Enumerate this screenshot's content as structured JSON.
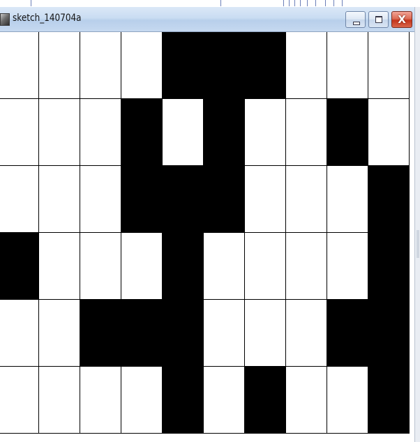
{
  "window": {
    "title": "sketch_140704a",
    "icon": "processing-app-icon",
    "controls": {
      "minimize_icon": "minimize-icon",
      "maximize_icon": "maximize-icon",
      "close_icon": "close-icon",
      "close_glyph": "X"
    }
  },
  "colors": {
    "filled_cell": "#000000",
    "empty_cell": "#ffffff",
    "grid_line": "#000000",
    "close_button": "#c4341b",
    "titlebar": "#c9dcf2"
  },
  "grid": {
    "columns_visible": 10,
    "rows_visible": 6,
    "cells": [
      [
        0,
        0,
        0,
        0,
        1,
        1,
        1,
        0,
        0,
        0
      ],
      [
        0,
        0,
        0,
        1,
        0,
        1,
        0,
        0,
        1,
        0
      ],
      [
        0,
        0,
        0,
        1,
        1,
        1,
        0,
        0,
        0,
        1
      ],
      [
        1,
        0,
        0,
        0,
        1,
        0,
        0,
        0,
        0,
        1
      ],
      [
        0,
        0,
        1,
        1,
        1,
        0,
        0,
        0,
        1,
        1
      ],
      [
        0,
        0,
        0,
        0,
        1,
        0,
        1,
        0,
        0,
        1
      ]
    ]
  }
}
